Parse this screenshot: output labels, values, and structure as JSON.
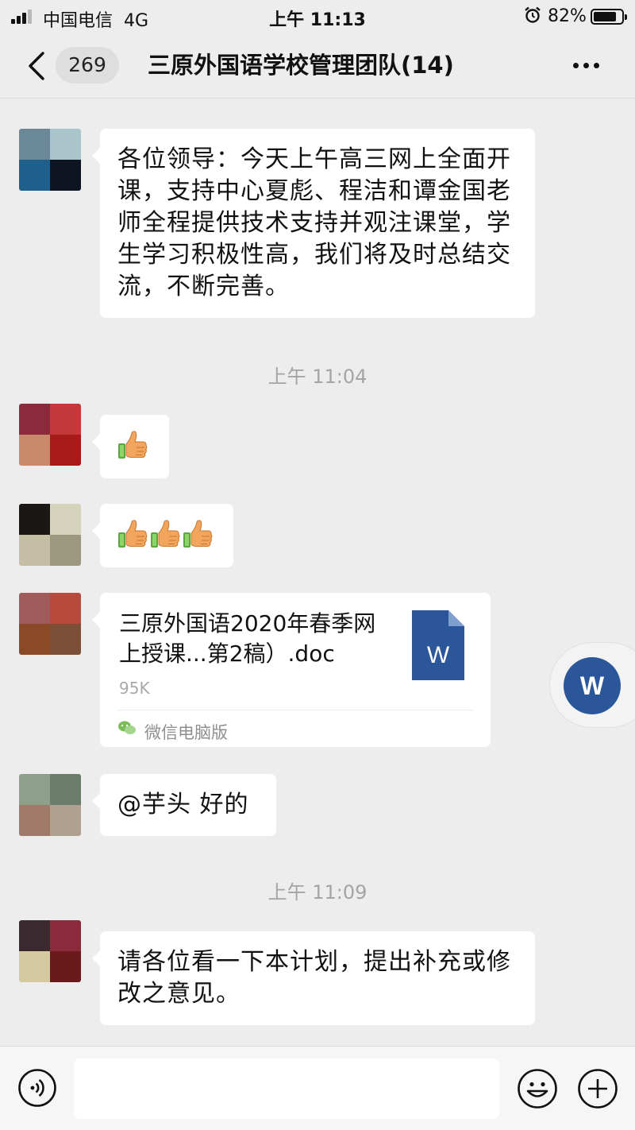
{
  "status_bar": {
    "carrier": "中国电信",
    "network": "4G",
    "time": "上午 11:13",
    "battery_percent": "82%",
    "battery_level": 0.82
  },
  "nav": {
    "unread_count": "269",
    "title": "三原外国语学校管理团队(14)"
  },
  "messages": [
    {
      "type": "text",
      "text": "各位领导：今天上午高三网上全面开课，支持中心夏彪、程洁和谭金国老师全程提供技术支持并观注课堂，学生学习积极性高，我们将及时总结交流，不断完善。"
    },
    {
      "type": "timestamp",
      "text": "上午 11:04"
    },
    {
      "type": "emoji",
      "emoji": "thumbs-up",
      "count": 1
    },
    {
      "type": "emoji",
      "emoji": "thumbs-up",
      "count": 3
    },
    {
      "type": "file",
      "file_name": "三原外国语2020年春季网上授课...第2稿）.doc",
      "file_size": "95K",
      "source": "微信电脑版",
      "file_icon_letter": "W"
    },
    {
      "type": "text",
      "text": "@芋头 好的"
    },
    {
      "type": "timestamp",
      "text": "上午 11:09"
    },
    {
      "type": "text",
      "text": "请各位看一下本计划，提出补充或修改之意见。"
    }
  ],
  "floating_doc": {
    "letter": "W"
  },
  "input_bar": {
    "value": "",
    "placeholder": ""
  },
  "colors": {
    "background": "#ededed",
    "bubble": "#ffffff",
    "word_blue": "#2b579a",
    "timestamp": "#a4a4a4"
  }
}
